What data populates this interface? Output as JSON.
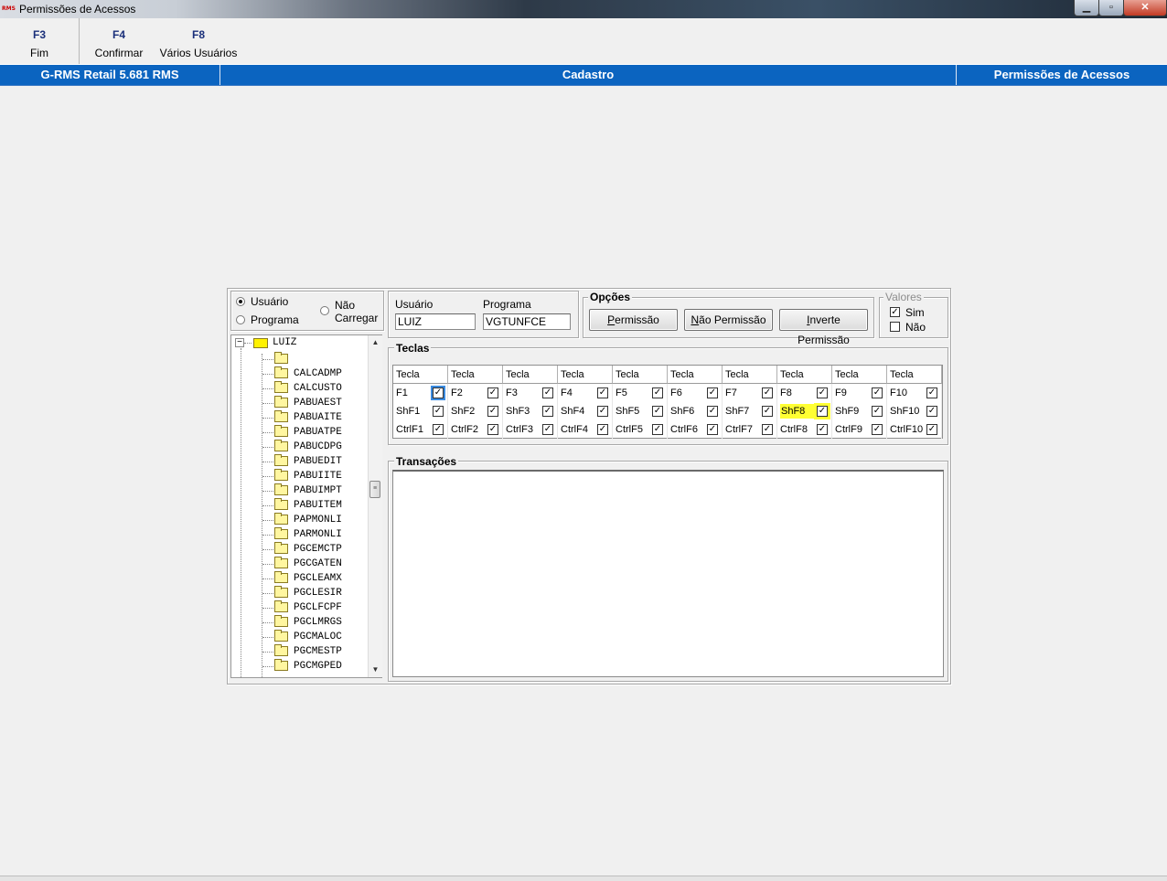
{
  "window": {
    "title": "Permissões de Acessos",
    "icon_text": "RMS",
    "minimize": "▁",
    "maximize": "▫",
    "close": "✕"
  },
  "fkeys": [
    {
      "key": "F3",
      "label": "Fim"
    },
    {
      "key": "F4",
      "label": "Confirmar"
    },
    {
      "key": "F8",
      "label": "Vários Usuários"
    }
  ],
  "header": {
    "left": "G-RMS Retail 5.681 RMS",
    "center": "Cadastro",
    "right": "Permissões de Acessos"
  },
  "view_mode": {
    "options": [
      {
        "label": "Usuário",
        "selected": true
      },
      {
        "label": "Programa",
        "selected": false
      }
    ],
    "nao_carregar_line1": "Não",
    "nao_carregar_line2": "Carregar"
  },
  "fields": {
    "usuario_label": "Usuário",
    "usuario_value": "LUIZ",
    "programa_label": "Programa",
    "programa_value": "VGTUNFCE"
  },
  "opcoes": {
    "legend": "Opções",
    "buttons": [
      {
        "mnemonic": "P",
        "rest": "ermissão"
      },
      {
        "mnemonic": "N",
        "rest": "ão Permissão"
      },
      {
        "mnemonic": "I",
        "rest": "nverte Permissão"
      }
    ]
  },
  "valores": {
    "legend": "Valores",
    "sim": "Sim",
    "nao": "Não",
    "sim_checked": true,
    "nao_checked": false
  },
  "tree": {
    "root": "LUIZ",
    "expander": "⊟",
    "items": [
      "",
      "CALCADMP",
      "CALCUSTO",
      "PABUAEST",
      "PABUAITE",
      "PABUATPE",
      "PABUCDPG",
      "PABUEDIT",
      "PABUIITE",
      "PABUIMPT",
      "PABUITEM",
      "PAPMONLI",
      "PARMONLI",
      "PGCEMCTP",
      "PGCGATEN",
      "PGCLEAMX",
      "PGCLESIR",
      "PGCLFCPF",
      "PGCLMRGS",
      "PGCMALOC",
      "PGCMESTP",
      "PGCMGPED"
    ],
    "scroll_up": "▲",
    "scroll_down": "▼",
    "thumb": "≡"
  },
  "teclas": {
    "legend": "Teclas",
    "header": "Tecla",
    "check_glyph": "✓",
    "rows": [
      [
        "F1",
        "F2",
        "F3",
        "F4",
        "F5",
        "F6",
        "F7",
        "F8",
        "F9",
        "F10"
      ],
      [
        "ShF1",
        "ShF2",
        "ShF3",
        "ShF4",
        "ShF5",
        "ShF6",
        "ShF7",
        "ShF8",
        "ShF9",
        "ShF10"
      ],
      [
        "CtrlF1",
        "CtrlF2",
        "CtrlF3",
        "CtrlF4",
        "CtrlF5",
        "CtrlF6",
        "CtrlF7",
        "CtrlF8",
        "CtrlF9",
        "CtrlF10"
      ]
    ],
    "highlight": {
      "row": 1,
      "col": 7,
      "color": "#ffff33"
    },
    "focused": {
      "row": 0,
      "col": 0
    }
  },
  "transacoes": {
    "legend": "Transações"
  },
  "colors": {
    "header_blue": "#0b64c0",
    "fkey_blue": "#1a2f7a"
  }
}
